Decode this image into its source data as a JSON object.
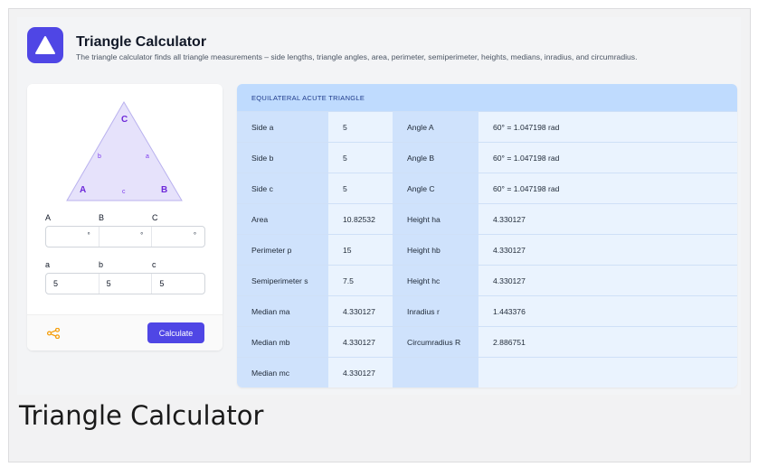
{
  "app": {
    "title": "Triangle Calculator",
    "description": "The triangle calculator finds all triangle measurements – side lengths, triangle angles, area, perimeter, semiperimeter, heights, medians, inradius, and circumradius.",
    "logo_icon": "triangle-logo-icon",
    "accent_color": "#4f46e5"
  },
  "diagram": {
    "vertex_a": "A",
    "vertex_b": "B",
    "vertex_c": "C",
    "side_a": "a",
    "side_b": "b",
    "side_c": "c"
  },
  "angles": {
    "labels": [
      "A",
      "B",
      "C"
    ],
    "values": [
      "",
      "",
      ""
    ],
    "unit": "°"
  },
  "sides": {
    "labels": [
      "a",
      "b",
      "c"
    ],
    "values": [
      "5",
      "5",
      "5"
    ]
  },
  "footer": {
    "share_icon": "share-icon",
    "calculate_label": "Calculate"
  },
  "results": {
    "heading": "EQUILATERAL ACUTE TRIANGLE",
    "rows": [
      {
        "l1": "Side a",
        "v1": "5",
        "l2": "Angle A",
        "v2": "60° = 1.047198 rad"
      },
      {
        "l1": "Side b",
        "v1": "5",
        "l2": "Angle B",
        "v2": "60° = 1.047198 rad"
      },
      {
        "l1": "Side c",
        "v1": "5",
        "l2": "Angle C",
        "v2": "60° = 1.047198 rad"
      },
      {
        "l1": "Area",
        "v1": "10.82532",
        "l2": "Height ha",
        "v2": "4.330127"
      },
      {
        "l1": "Perimeter p",
        "v1": "15",
        "l2": "Height hb",
        "v2": "4.330127"
      },
      {
        "l1": "Semiperimeter s",
        "v1": "7.5",
        "l2": "Height hc",
        "v2": "4.330127"
      },
      {
        "l1": "Median ma",
        "v1": "4.330127",
        "l2": "Inradius r",
        "v2": "1.443376"
      },
      {
        "l1": "Median mb",
        "v1": "4.330127",
        "l2": "Circumradius R",
        "v2": "2.886751"
      },
      {
        "l1": "Median mc",
        "v1": "4.330127",
        "l2": "",
        "v2": ""
      }
    ]
  },
  "caption": "Triangle Calculator"
}
